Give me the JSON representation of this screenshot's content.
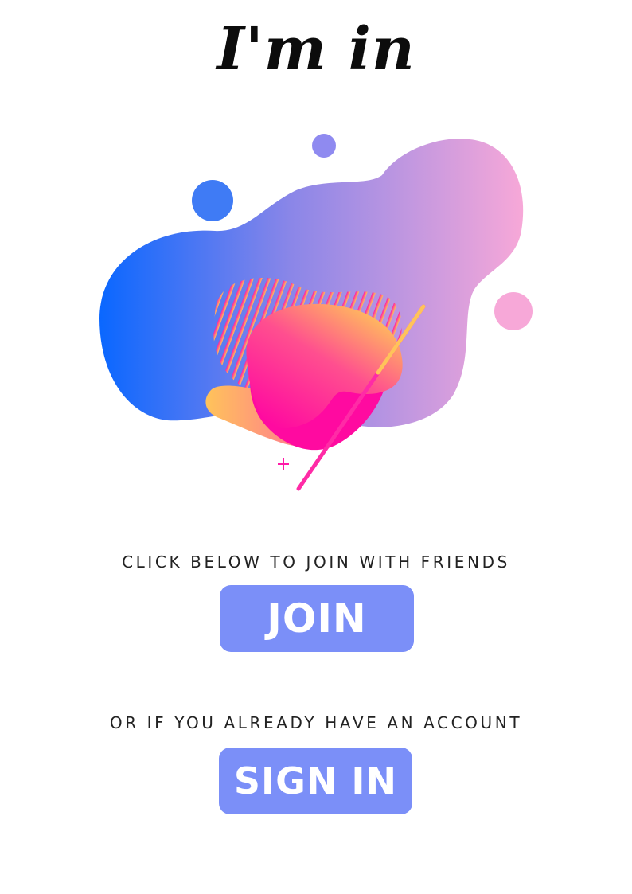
{
  "header": {
    "title": "I'm in"
  },
  "hero": {
    "icon": "abstract-blob-illustration",
    "colors": {
      "blue": "#0a67ff",
      "violet": "#8a86e8",
      "pink": "#f7a8d8",
      "magenta": "#ff1aa8",
      "orange": "#ffc35a"
    }
  },
  "join_section": {
    "caption": "CLICK BELOW TO JOIN WITH FRIENDS",
    "button_label": "JOIN"
  },
  "signin_section": {
    "caption": "OR IF YOU ALREADY HAVE AN ACCOUNT",
    "button_label": "SIGN IN"
  },
  "theme": {
    "button_color": "#7b8ff8",
    "text_color": "#222222"
  }
}
